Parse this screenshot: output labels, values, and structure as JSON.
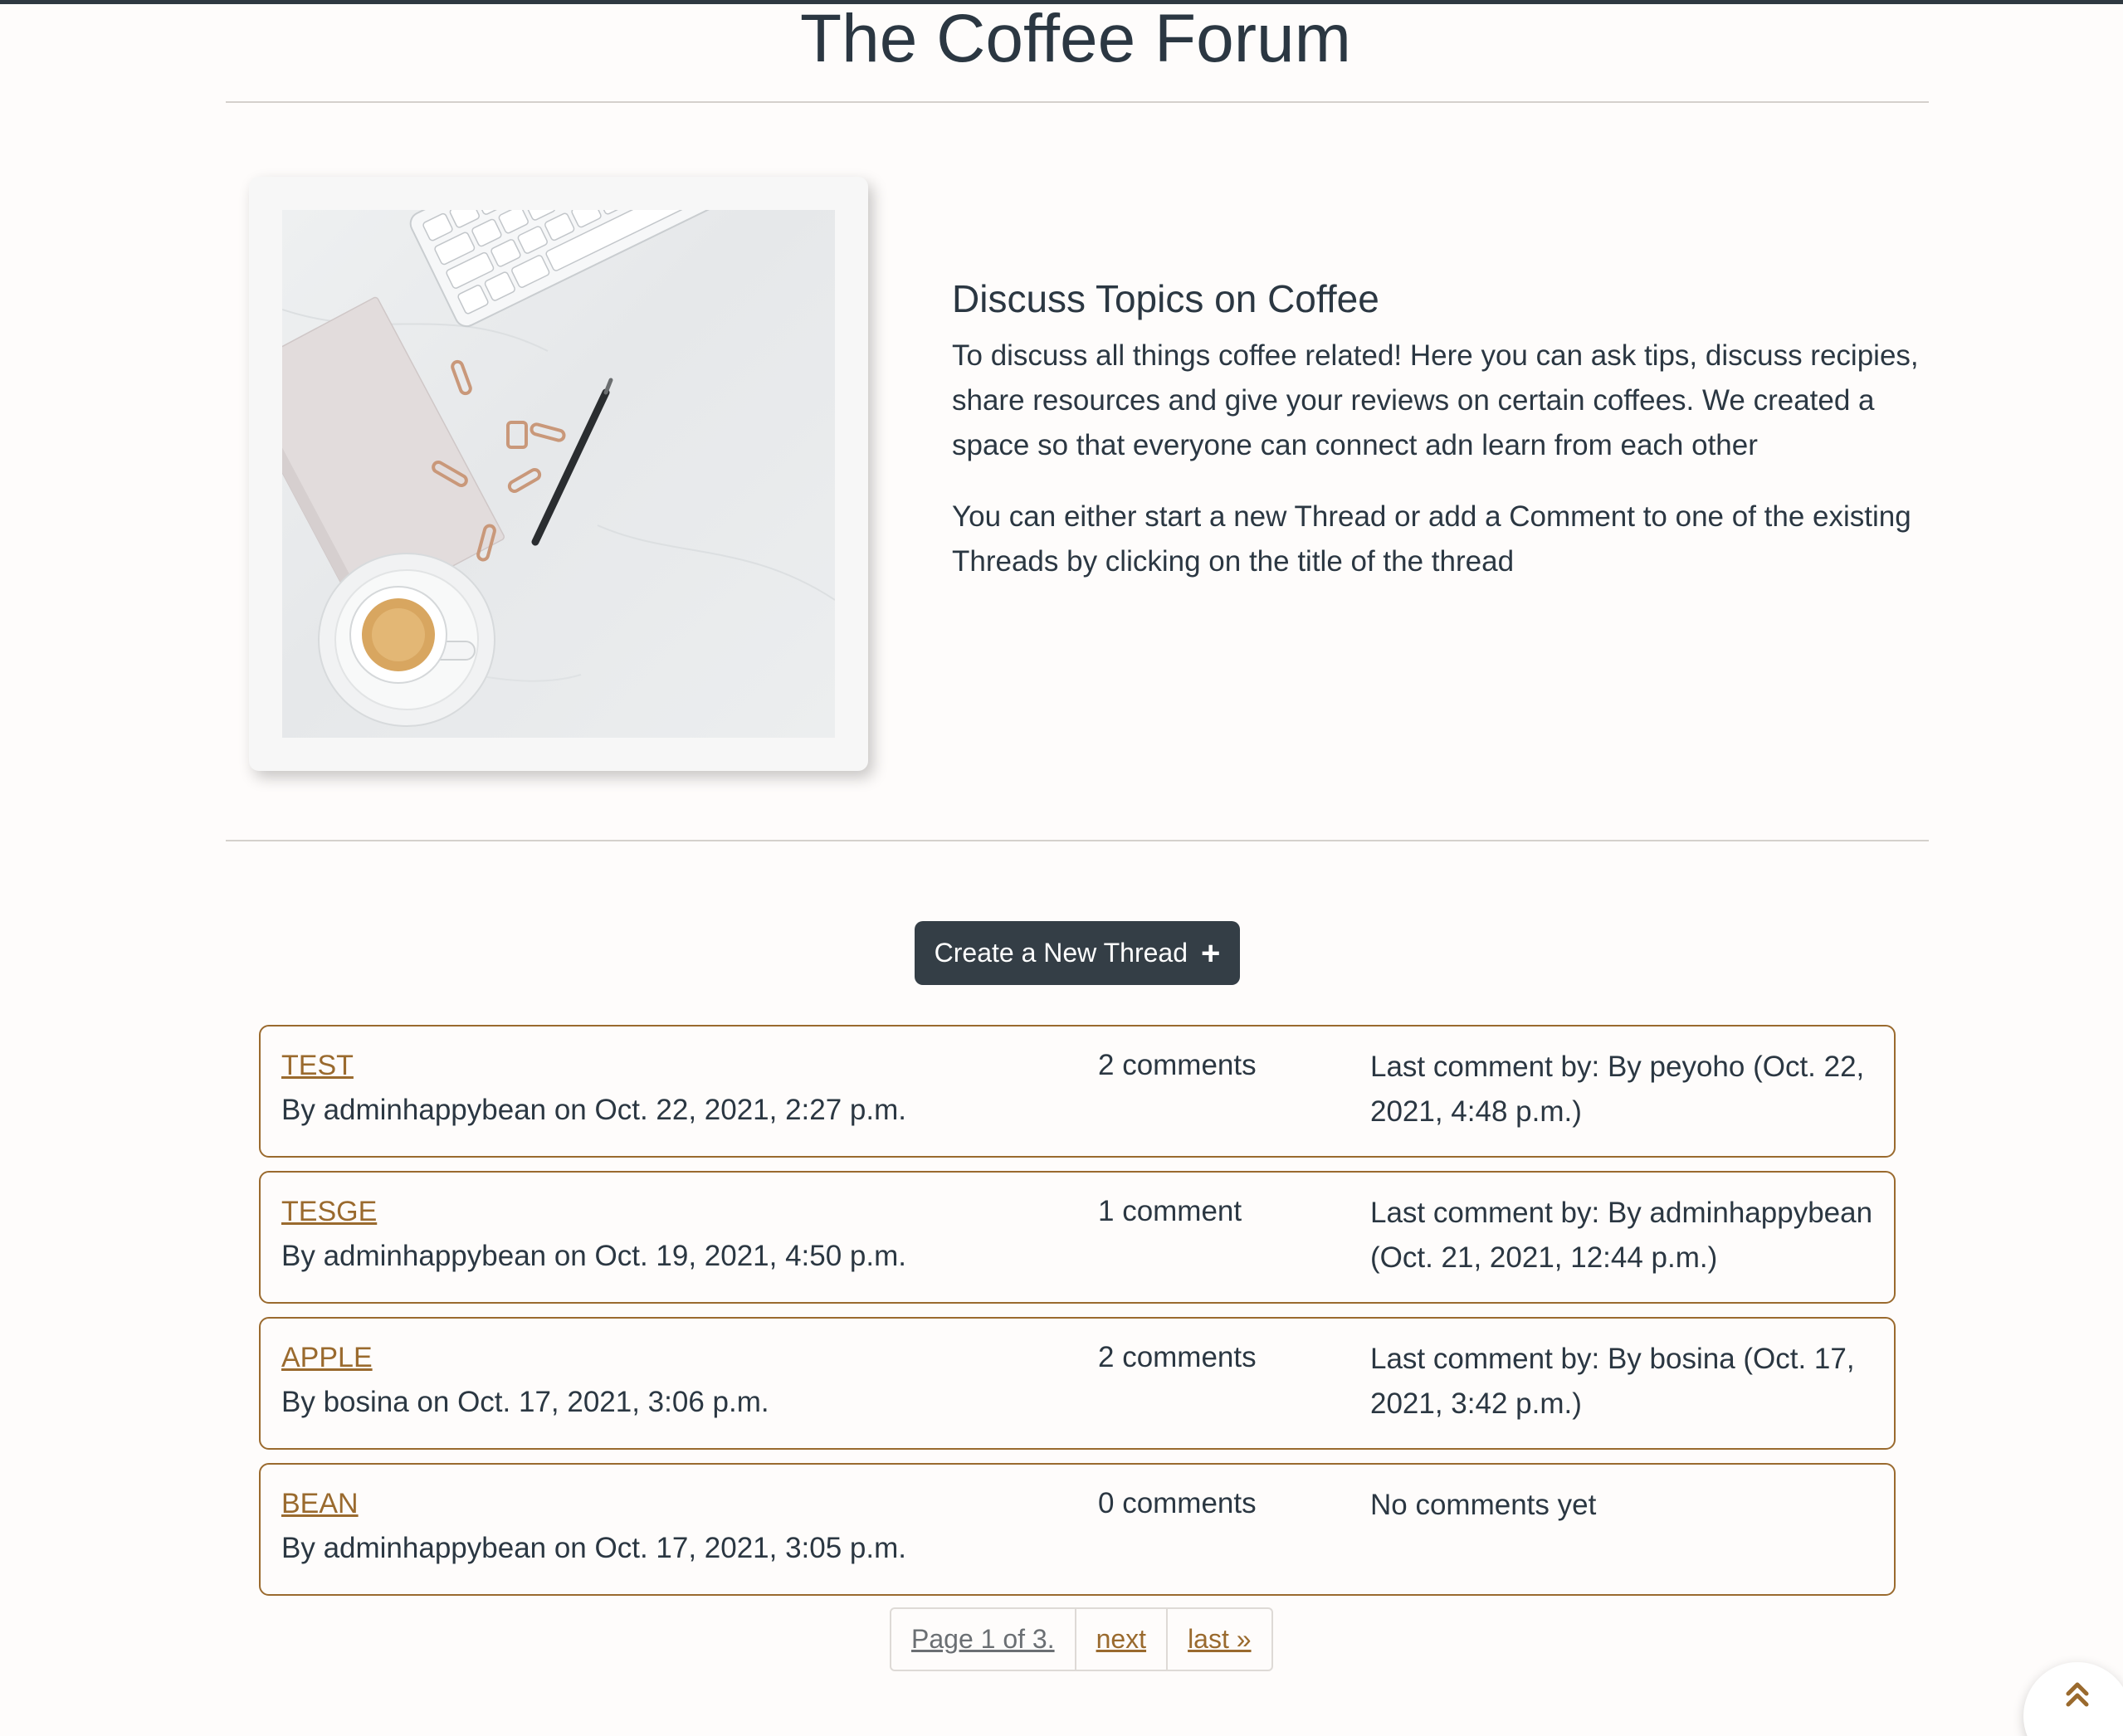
{
  "site": {
    "title": "The Coffee Forum"
  },
  "intro": {
    "heading": "Discuss Topics on Coffee",
    "paragraph1": "To discuss all things coffee related! Here you can ask tips, discuss recipies, share resources and give your reviews on certain coffees. We created a space so that everyone can connect adn learn from each other",
    "paragraph2": "You can either start a new Thread or add a Comment to one of the existing Threads by clicking on the title of the thread"
  },
  "create_button": {
    "label": "Create a New Thread",
    "icon": "plus-icon"
  },
  "threads": [
    {
      "title": "TEST",
      "byline": "By adminhappybean on Oct. 22, 2021, 2:27 p.m.",
      "comments": "2 comments",
      "last": "Last comment by: By peyoho (Oct. 22, 2021, 4:48 p.m.)"
    },
    {
      "title": "TESGE",
      "byline": "By adminhappybean on Oct. 19, 2021, 4:50 p.m.",
      "comments": "1 comment",
      "last": "Last comment by: By adminhappybean (Oct. 21, 2021, 12:44 p.m.)"
    },
    {
      "title": "APPLE",
      "byline": "By bosina on Oct. 17, 2021, 3:06 p.m.",
      "comments": "2 comments",
      "last": "Last comment by: By bosina (Oct. 17, 2021, 3:42 p.m.)"
    },
    {
      "title": "BEAN",
      "byline": "By adminhappybean on Oct. 17, 2021, 3:05 p.m.",
      "comments": "0 comments",
      "last": "No comments yet"
    }
  ],
  "pagination": {
    "current": "Page 1 of 3.",
    "next": "next",
    "last": "last »"
  },
  "back_to_top": {
    "icon": "double-chevron-up-icon"
  },
  "colors": {
    "accent": "#9a6a2e",
    "button": "#343e46",
    "text": "#2b3742"
  }
}
